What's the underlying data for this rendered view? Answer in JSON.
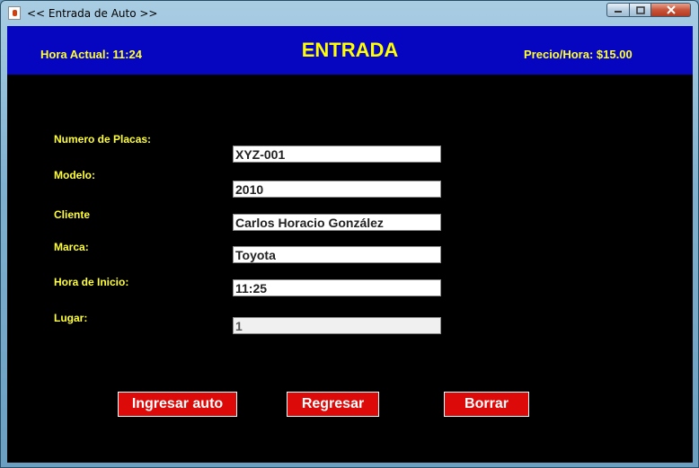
{
  "window": {
    "title": "<< Entrada de Auto >>"
  },
  "header": {
    "hora_actual": "Hora Actual: 11:24",
    "title": "ENTRADA",
    "precio_hora": "Precio/Hora: $15.00"
  },
  "form": {
    "placas": {
      "label": "Numero de Placas:",
      "value": "XYZ-001"
    },
    "modelo": {
      "label": "Modelo:",
      "value": "2010"
    },
    "cliente": {
      "label": "Cliente",
      "value": "Carlos Horacio González"
    },
    "marca": {
      "label": "Marca:",
      "value": "Toyota"
    },
    "hora_inicio": {
      "label": "Hora de Inicio:",
      "value": "11:25"
    },
    "lugar": {
      "label": "Lugar:",
      "value": "1"
    }
  },
  "buttons": {
    "ingresar": "Ingresar auto",
    "regresar": "Regresar",
    "borrar": "Borrar"
  },
  "colors": {
    "header_bg": "#0606C0",
    "label_yellow": "#FFFF33",
    "button_red": "#DD0A0A",
    "body_bg": "#000000"
  }
}
